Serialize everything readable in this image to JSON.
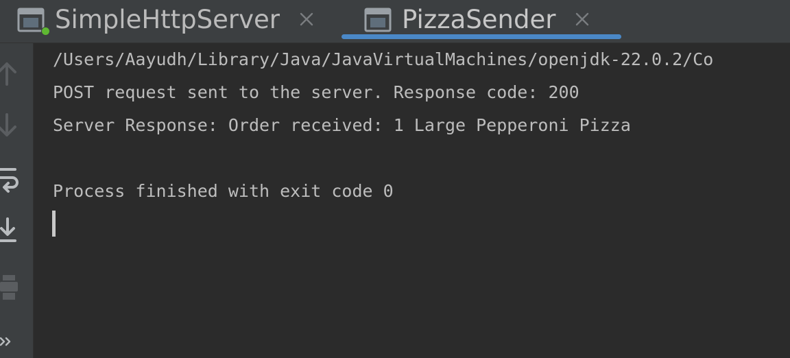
{
  "tabs": [
    {
      "label": "SimpleHttpServer",
      "icon": "console-window-icon",
      "running": true,
      "active": false
    },
    {
      "label": "PizzaSender",
      "icon": "console-window-icon",
      "running": false,
      "active": true
    }
  ],
  "gutter": {
    "buttons": [
      "scroll-up-icon",
      "scroll-down-icon",
      "soft-wrap-icon",
      "scroll-to-end-icon",
      "print-icon",
      "more-icon"
    ]
  },
  "console": {
    "lines": [
      "/Users/Aayudh/Library/Java/JavaVirtualMachines/openjdk-22.0.2/Co",
      "POST request sent to the server. Response code: 200",
      "Server Response: Order received: 1 Large Pepperoni Pizza",
      "Process finished with exit code 0"
    ]
  },
  "colors": {
    "background": "#2b2b2b",
    "toolbar": "#3c3f41",
    "text": "#bdbdbd",
    "accent": "#4a88c7",
    "running": "#5fb832"
  }
}
